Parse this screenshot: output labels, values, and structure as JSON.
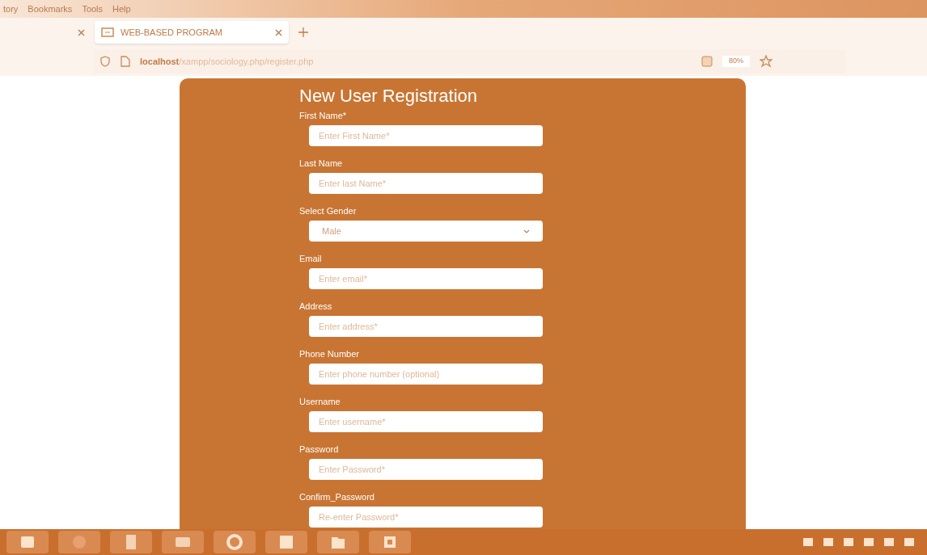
{
  "menu_bar": [
    "tory",
    "Bookmarks",
    "Tools",
    "Help"
  ],
  "tabs": [
    {
      "label": "WEB-BASED PROGRAM",
      "selected": true
    }
  ],
  "address_bar": {
    "url": "**localhost**/xampp/sociology.php/register.php",
    "zoom": "80%"
  },
  "form": {
    "title": "New User Registration",
    "fields": [
      {
        "kind": "input",
        "label": "First Name*",
        "placeholder": "Enter First Name*"
      },
      {
        "kind": "input",
        "label": "Last Name",
        "placeholder": "Enter last Name*"
      },
      {
        "kind": "select",
        "label": "Select Gender",
        "value": "Male"
      },
      {
        "kind": "input",
        "label": "Email",
        "placeholder": "Enter email*"
      },
      {
        "kind": "input",
        "label": "Address",
        "placeholder": "Enter address*"
      },
      {
        "kind": "input",
        "label": "Phone Number",
        "placeholder": "Enter phone number (optional)"
      },
      {
        "kind": "input",
        "label": "Username",
        "placeholder": "Enter username*"
      },
      {
        "kind": "input",
        "label": "Password",
        "placeholder": "Enter Password*"
      },
      {
        "kind": "input",
        "label": "Confirm_Password",
        "placeholder": "Re-enter Password*"
      }
    ]
  }
}
